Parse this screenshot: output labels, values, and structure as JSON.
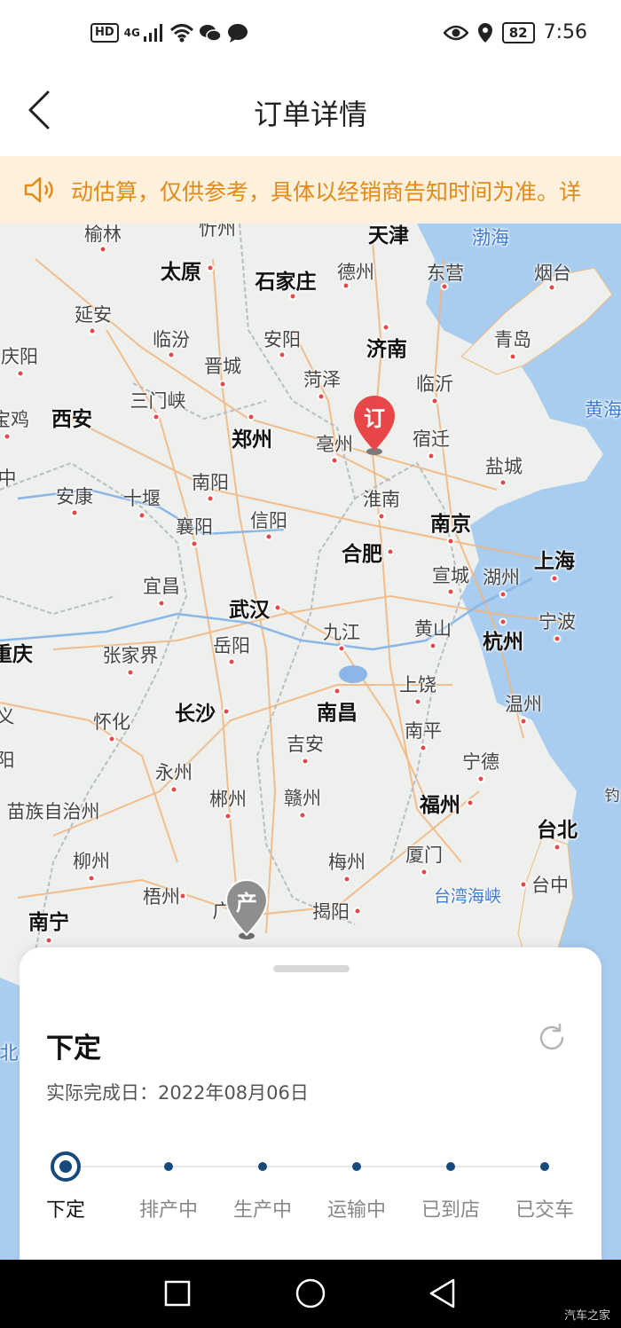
{
  "statusbar": {
    "hd": "HD",
    "network": "4G",
    "battery": "82",
    "time": "7:56",
    "icons": [
      "signal-icon",
      "wifi-icon",
      "wechat-icon",
      "message-icon",
      "eye-icon",
      "location-icon"
    ]
  },
  "header": {
    "back_icon": "chevron-left-icon",
    "title": "订单详情"
  },
  "notice": {
    "icon": "speaker-icon",
    "text": "动估算，仅供参考，具体以经销商告知时间为准。详"
  },
  "map": {
    "cities": [
      "榆林",
      "忻州",
      "天津",
      "渤海",
      "太原",
      "石家庄",
      "德州",
      "东营",
      "烟台",
      "延安",
      "临汾",
      "安阳",
      "济南",
      "青岛",
      "庆阳",
      "晋城",
      "菏泽",
      "临沂",
      "黄海",
      "宝鸡",
      "西安",
      "三门峡",
      "郑州",
      "亳州",
      "宿迁",
      "盐城",
      "中",
      "安康",
      "十堰",
      "南阳",
      "淮南",
      "南京",
      "襄阳",
      "信阳",
      "合肥",
      "上海",
      "宜昌",
      "宣城",
      "湖州",
      "武汉",
      "九江",
      "黄山",
      "宁波",
      "杭州",
      "重庆",
      "张家界",
      "岳阳",
      "上饶",
      "怀化",
      "长沙",
      "南昌",
      "温州",
      "义",
      "吉安",
      "南平",
      "阳",
      "永州",
      "宁德",
      "苗族自治州",
      "郴州",
      "赣州",
      "福州",
      "钓",
      "台北",
      "柳州",
      "梅州",
      "厦门",
      "台中",
      "梧州",
      "广",
      "台湾海峡",
      "揭阳",
      "南宁",
      "北"
    ],
    "pins": [
      {
        "label": "订",
        "color": "#e8474a"
      },
      {
        "label": "产",
        "color": "#8e8e8e"
      }
    ]
  },
  "sheet": {
    "stage": "下定",
    "done_label": "实际完成日：2022年08月06日",
    "refresh_icon": "refresh-icon",
    "steps": [
      "下定",
      "排产中",
      "生产中",
      "运输中",
      "已到店",
      "已交车"
    ],
    "active_step": 0
  },
  "navbar": {
    "icons": [
      "recent-apps-icon",
      "home-icon",
      "back-triangle-icon"
    ],
    "watermark": "汽车之家"
  },
  "colors": {
    "accent": "#174a7c",
    "notice_bg": "#fdf1dd",
    "notice_text": "#e28a17",
    "pin_red": "#e8474a",
    "sea": "#a9cdf0"
  }
}
